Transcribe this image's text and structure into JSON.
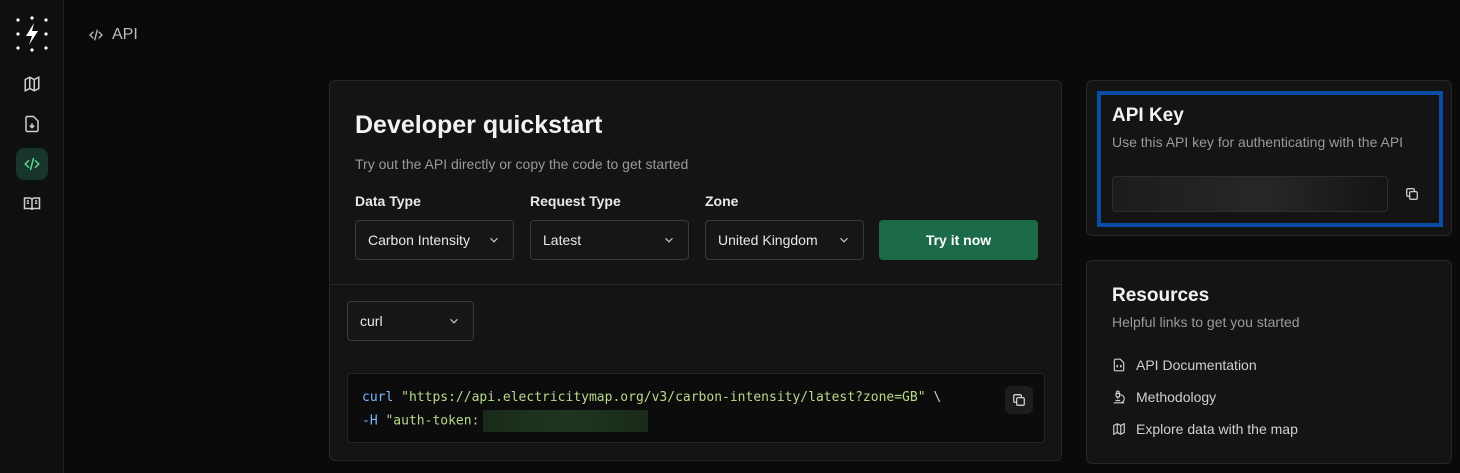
{
  "breadcrumb": {
    "label": "API"
  },
  "sidebar": {
    "items": [
      {
        "name": "map"
      },
      {
        "name": "download"
      },
      {
        "name": "api",
        "active": true
      },
      {
        "name": "docs"
      }
    ]
  },
  "quickstart": {
    "title": "Developer quickstart",
    "subtitle": "Try out the API directly or copy the code to get started",
    "data_type": {
      "label": "Data Type",
      "value": "Carbon Intensity"
    },
    "request_type": {
      "label": "Request Type",
      "value": "Latest"
    },
    "zone": {
      "label": "Zone",
      "value": "United Kingdom"
    },
    "try_button": "Try it now",
    "language": {
      "value": "curl"
    },
    "code": {
      "line1_cmd": "curl",
      "line1_url": "\"https://api.electricitymap.org/v3/carbon-intensity/latest?zone=GB\"",
      "line1_cont": " \\",
      "line2_flag": "-H",
      "line2_header": "\"auth-token:"
    }
  },
  "api_key": {
    "title": "API Key",
    "subtitle": "Use this API key for authenticating with the API"
  },
  "resources": {
    "title": "Resources",
    "subtitle": "Helpful links to get you started",
    "links": [
      {
        "label": "API Documentation"
      },
      {
        "label": "Methodology"
      },
      {
        "label": "Explore data with the map"
      }
    ]
  },
  "colors": {
    "accent_green": "#1b6a48",
    "highlight_blue": "#0a4ea4",
    "background": "#0a0a0a"
  }
}
